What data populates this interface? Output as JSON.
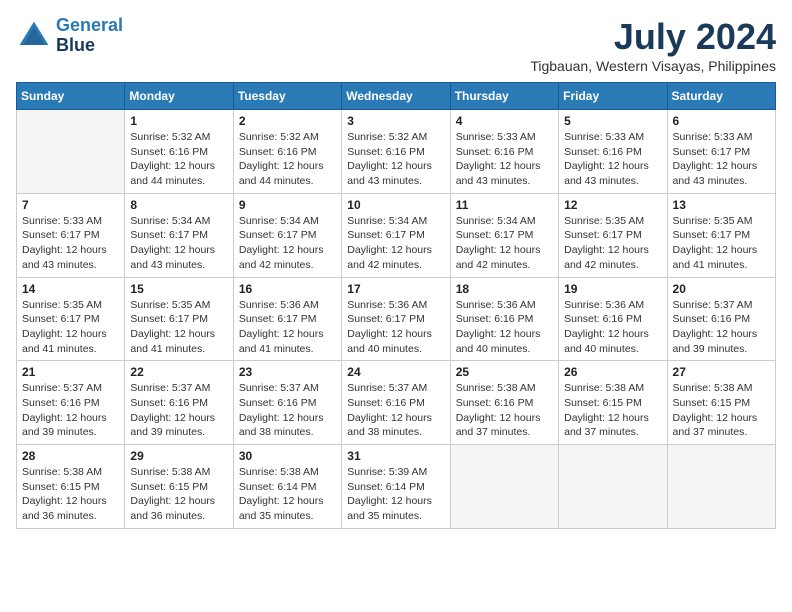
{
  "header": {
    "logo_line1": "General",
    "logo_line2": "Blue",
    "month": "July 2024",
    "location": "Tigbauan, Western Visayas, Philippines"
  },
  "weekdays": [
    "Sunday",
    "Monday",
    "Tuesday",
    "Wednesday",
    "Thursday",
    "Friday",
    "Saturday"
  ],
  "weeks": [
    [
      {
        "day": "",
        "info": ""
      },
      {
        "day": "1",
        "info": "Sunrise: 5:32 AM\nSunset: 6:16 PM\nDaylight: 12 hours\nand 44 minutes."
      },
      {
        "day": "2",
        "info": "Sunrise: 5:32 AM\nSunset: 6:16 PM\nDaylight: 12 hours\nand 44 minutes."
      },
      {
        "day": "3",
        "info": "Sunrise: 5:32 AM\nSunset: 6:16 PM\nDaylight: 12 hours\nand 43 minutes."
      },
      {
        "day": "4",
        "info": "Sunrise: 5:33 AM\nSunset: 6:16 PM\nDaylight: 12 hours\nand 43 minutes."
      },
      {
        "day": "5",
        "info": "Sunrise: 5:33 AM\nSunset: 6:16 PM\nDaylight: 12 hours\nand 43 minutes."
      },
      {
        "day": "6",
        "info": "Sunrise: 5:33 AM\nSunset: 6:17 PM\nDaylight: 12 hours\nand 43 minutes."
      }
    ],
    [
      {
        "day": "7",
        "info": "Sunrise: 5:33 AM\nSunset: 6:17 PM\nDaylight: 12 hours\nand 43 minutes."
      },
      {
        "day": "8",
        "info": "Sunrise: 5:34 AM\nSunset: 6:17 PM\nDaylight: 12 hours\nand 43 minutes."
      },
      {
        "day": "9",
        "info": "Sunrise: 5:34 AM\nSunset: 6:17 PM\nDaylight: 12 hours\nand 42 minutes."
      },
      {
        "day": "10",
        "info": "Sunrise: 5:34 AM\nSunset: 6:17 PM\nDaylight: 12 hours\nand 42 minutes."
      },
      {
        "day": "11",
        "info": "Sunrise: 5:34 AM\nSunset: 6:17 PM\nDaylight: 12 hours\nand 42 minutes."
      },
      {
        "day": "12",
        "info": "Sunrise: 5:35 AM\nSunset: 6:17 PM\nDaylight: 12 hours\nand 42 minutes."
      },
      {
        "day": "13",
        "info": "Sunrise: 5:35 AM\nSunset: 6:17 PM\nDaylight: 12 hours\nand 41 minutes."
      }
    ],
    [
      {
        "day": "14",
        "info": "Sunrise: 5:35 AM\nSunset: 6:17 PM\nDaylight: 12 hours\nand 41 minutes."
      },
      {
        "day": "15",
        "info": "Sunrise: 5:35 AM\nSunset: 6:17 PM\nDaylight: 12 hours\nand 41 minutes."
      },
      {
        "day": "16",
        "info": "Sunrise: 5:36 AM\nSunset: 6:17 PM\nDaylight: 12 hours\nand 41 minutes."
      },
      {
        "day": "17",
        "info": "Sunrise: 5:36 AM\nSunset: 6:17 PM\nDaylight: 12 hours\nand 40 minutes."
      },
      {
        "day": "18",
        "info": "Sunrise: 5:36 AM\nSunset: 6:16 PM\nDaylight: 12 hours\nand 40 minutes."
      },
      {
        "day": "19",
        "info": "Sunrise: 5:36 AM\nSunset: 6:16 PM\nDaylight: 12 hours\nand 40 minutes."
      },
      {
        "day": "20",
        "info": "Sunrise: 5:37 AM\nSunset: 6:16 PM\nDaylight: 12 hours\nand 39 minutes."
      }
    ],
    [
      {
        "day": "21",
        "info": "Sunrise: 5:37 AM\nSunset: 6:16 PM\nDaylight: 12 hours\nand 39 minutes."
      },
      {
        "day": "22",
        "info": "Sunrise: 5:37 AM\nSunset: 6:16 PM\nDaylight: 12 hours\nand 39 minutes."
      },
      {
        "day": "23",
        "info": "Sunrise: 5:37 AM\nSunset: 6:16 PM\nDaylight: 12 hours\nand 38 minutes."
      },
      {
        "day": "24",
        "info": "Sunrise: 5:37 AM\nSunset: 6:16 PM\nDaylight: 12 hours\nand 38 minutes."
      },
      {
        "day": "25",
        "info": "Sunrise: 5:38 AM\nSunset: 6:16 PM\nDaylight: 12 hours\nand 37 minutes."
      },
      {
        "day": "26",
        "info": "Sunrise: 5:38 AM\nSunset: 6:15 PM\nDaylight: 12 hours\nand 37 minutes."
      },
      {
        "day": "27",
        "info": "Sunrise: 5:38 AM\nSunset: 6:15 PM\nDaylight: 12 hours\nand 37 minutes."
      }
    ],
    [
      {
        "day": "28",
        "info": "Sunrise: 5:38 AM\nSunset: 6:15 PM\nDaylight: 12 hours\nand 36 minutes."
      },
      {
        "day": "29",
        "info": "Sunrise: 5:38 AM\nSunset: 6:15 PM\nDaylight: 12 hours\nand 36 minutes."
      },
      {
        "day": "30",
        "info": "Sunrise: 5:38 AM\nSunset: 6:14 PM\nDaylight: 12 hours\nand 35 minutes."
      },
      {
        "day": "31",
        "info": "Sunrise: 5:39 AM\nSunset: 6:14 PM\nDaylight: 12 hours\nand 35 minutes."
      },
      {
        "day": "",
        "info": ""
      },
      {
        "day": "",
        "info": ""
      },
      {
        "day": "",
        "info": ""
      }
    ]
  ]
}
